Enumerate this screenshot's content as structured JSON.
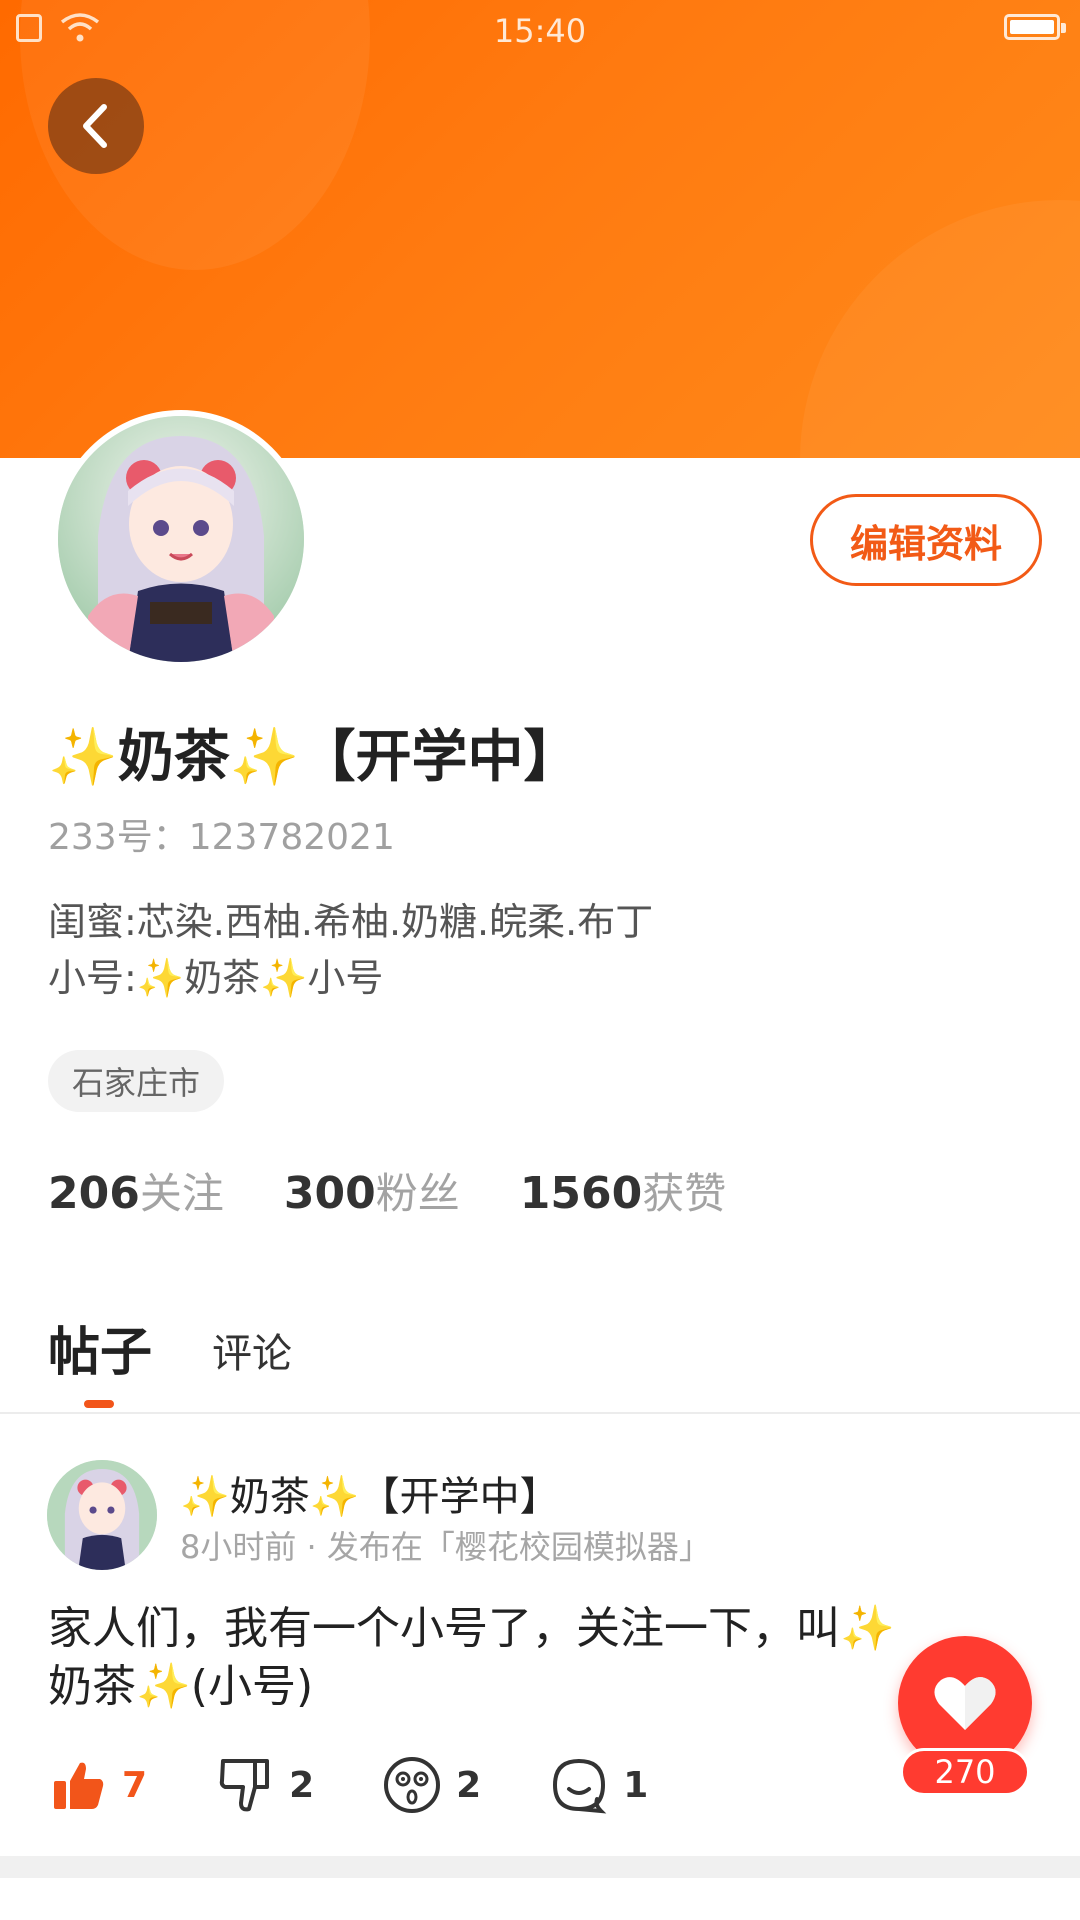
{
  "status_bar": {
    "time": "15:40"
  },
  "profile": {
    "nickname": "✨奶茶✨【开学中】",
    "uid": "233号：123782021",
    "bio_lines": [
      "闺蜜:芯染.西柚.希柚.奶糖.皖柔.布丁",
      "小号:✨奶茶✨小号"
    ],
    "location": "石家庄市",
    "edit_label": "编辑资料",
    "stats": [
      {
        "num": "206",
        "label": "关注"
      },
      {
        "num": "300",
        "label": "粉丝"
      },
      {
        "num": "1560",
        "label": "获赞"
      }
    ]
  },
  "tabs": [
    {
      "label": "帖子",
      "active": true
    },
    {
      "label": "评论",
      "active": false
    }
  ],
  "post": {
    "author": "✨奶茶✨【开学中】",
    "meta": "8小时前 · 发布在「樱花校园模拟器」",
    "content": "家人们，我有一个小号了，关注一下，叫✨奶茶✨(小号)",
    "actions": {
      "like": {
        "icon": "thumbs-up-icon",
        "count": "7"
      },
      "dislike": {
        "icon": "thumbs-down-icon",
        "count": "2"
      },
      "surprise": {
        "icon": "surprised-face-icon",
        "count": "2"
      },
      "comment": {
        "icon": "comment-icon",
        "count": "1"
      }
    }
  },
  "fab": {
    "icon": "heart-icon",
    "count": "270"
  },
  "colors": {
    "accent": "#f2551a",
    "header": "#ff7a10",
    "fab": "#ff3b30"
  }
}
